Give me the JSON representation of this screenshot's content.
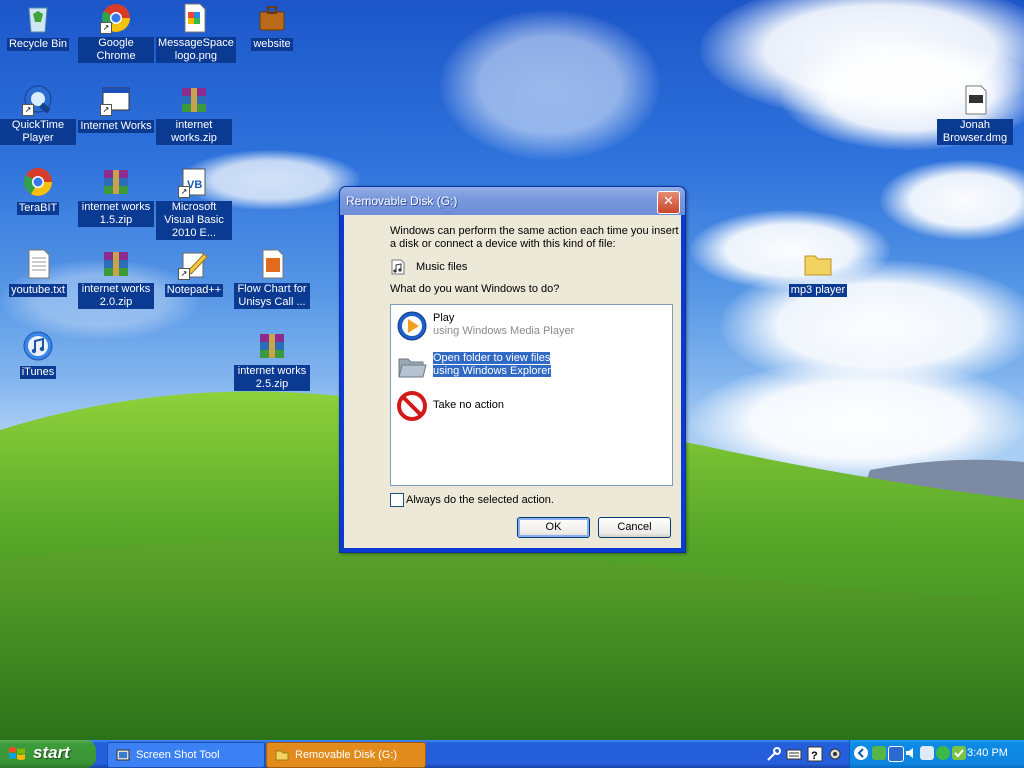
{
  "desktop": {
    "icons": [
      {
        "label": "Recycle Bin"
      },
      {
        "label": "Google Chrome"
      },
      {
        "label": "MessageSpace logo.png"
      },
      {
        "label": "website"
      },
      {
        "label": "QuickTime Player"
      },
      {
        "label": "Internet Works"
      },
      {
        "label": "internet works.zip"
      },
      {
        "label": "TeraBIT"
      },
      {
        "label": "internet works 1.5.zip"
      },
      {
        "label": "Microsoft Visual Basic 2010 E..."
      },
      {
        "label": "youtube.txt"
      },
      {
        "label": "internet works 2.0.zip"
      },
      {
        "label": "Notepad++"
      },
      {
        "label": "Flow Chart for Unisys Call ..."
      },
      {
        "label": "iTunes"
      },
      {
        "label": "internet works 2.5.zip"
      },
      {
        "label": "Jonah Browser.dmg"
      },
      {
        "label": "mp3 player"
      }
    ]
  },
  "dialog": {
    "title": "Removable Disk (G:)",
    "close_symbol": "✕",
    "intro": "Windows can perform the same action each time you insert a disk or connect a device with this kind of file:",
    "content_type": "Music files",
    "question": "What do you want Windows to do?",
    "options": [
      {
        "title": "Play",
        "subtitle": "using Windows Media Player",
        "icon": "windows-media-player-icon"
      },
      {
        "title": "Open folder to view files",
        "subtitle": "using Windows Explorer",
        "icon": "folder-icon",
        "selected": true
      },
      {
        "title": "Take no action",
        "subtitle": "",
        "icon": "no-action-icon"
      }
    ],
    "always_checkbox": "Always do the selected action.",
    "ok_label": "OK",
    "cancel_label": "Cancel"
  },
  "taskbar": {
    "start_label": "start",
    "tasks": [
      {
        "label": "Screen Shot Tool",
        "active": false
      },
      {
        "label": "Removable Disk (G:)",
        "active": true
      }
    ],
    "clock": "3:40 PM"
  }
}
